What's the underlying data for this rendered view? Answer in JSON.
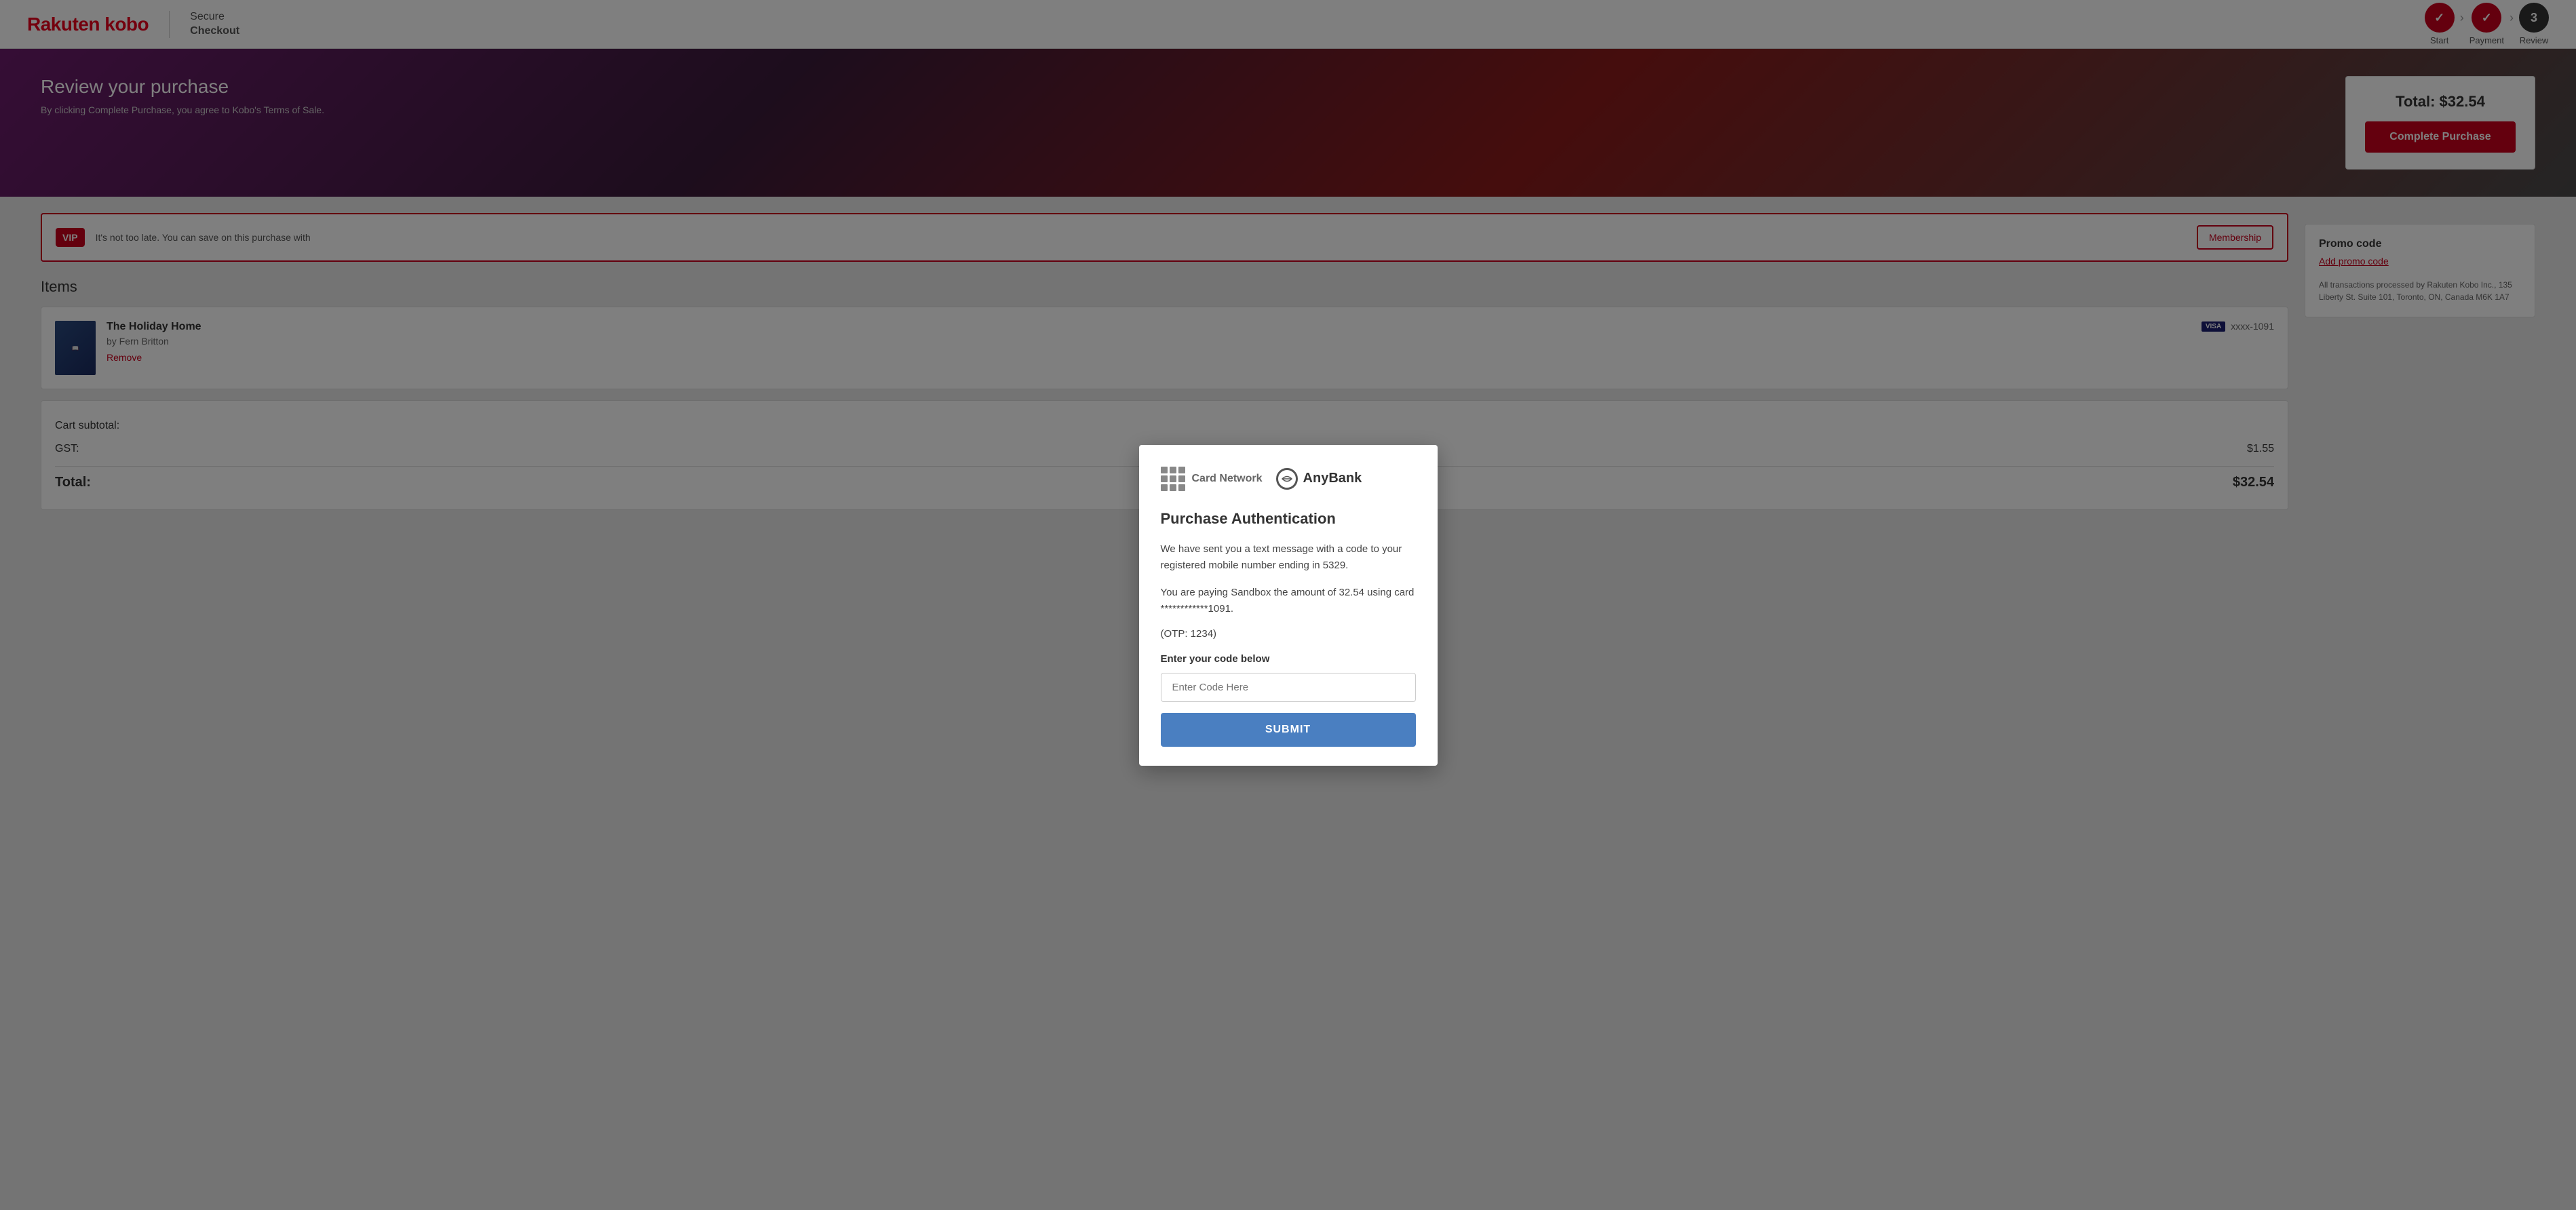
{
  "header": {
    "logo": "Rakuten kobo",
    "secure_checkout_line1": "Secure",
    "secure_checkout_line2": "Checkout",
    "steps": [
      {
        "id": "start",
        "label": "Start",
        "state": "done",
        "number": "✓"
      },
      {
        "id": "payment",
        "label": "Payment",
        "state": "done",
        "number": "✓"
      },
      {
        "id": "review",
        "label": "Review",
        "state": "current",
        "number": "3"
      }
    ]
  },
  "banner": {
    "title": "Review your purchase",
    "subtitle": "By clicking Complete Purchase, you agree to Kobo's Terms of Sale."
  },
  "purchase_box": {
    "total_label": "Total: $32.54",
    "button_label": "Complete Purchase"
  },
  "vip_banner": {
    "badge": "VIP",
    "text": "It's not too late. You can save on this purchase with",
    "button_label": "Membership"
  },
  "items_section": {
    "heading": "Items",
    "items": [
      {
        "title": "The Holiday Home",
        "author": "by Fern Britton",
        "remove_label": "Remove",
        "card_last4": "xxxx-1091"
      }
    ]
  },
  "cart": {
    "subtotal_label": "Cart subtotal:",
    "gst_label": "GST:",
    "gst_value": "$1.55",
    "total_label": "Total:",
    "total_value": "$32.54"
  },
  "promo": {
    "label": "Promo code",
    "add_label": "Add promo code"
  },
  "transactions_note": "All transactions processed by Rakuten Kobo Inc., 135 Liberty St. Suite 101, Toronto, ON, Canada M6K 1A7",
  "modal": {
    "card_network_label": "Card Network",
    "anybank_label": "AnyBank",
    "title": "Purchase Authentication",
    "body1": "We have sent you a text message with a code to your registered mobile number ending in 5329.",
    "body2": "You are paying Sandbox the amount of 32.54 using card ************1091.",
    "otp_hint": "(OTP: 1234)",
    "code_label": "Enter your code below",
    "code_placeholder": "Enter Code Here",
    "submit_label": "SUBMIT"
  }
}
